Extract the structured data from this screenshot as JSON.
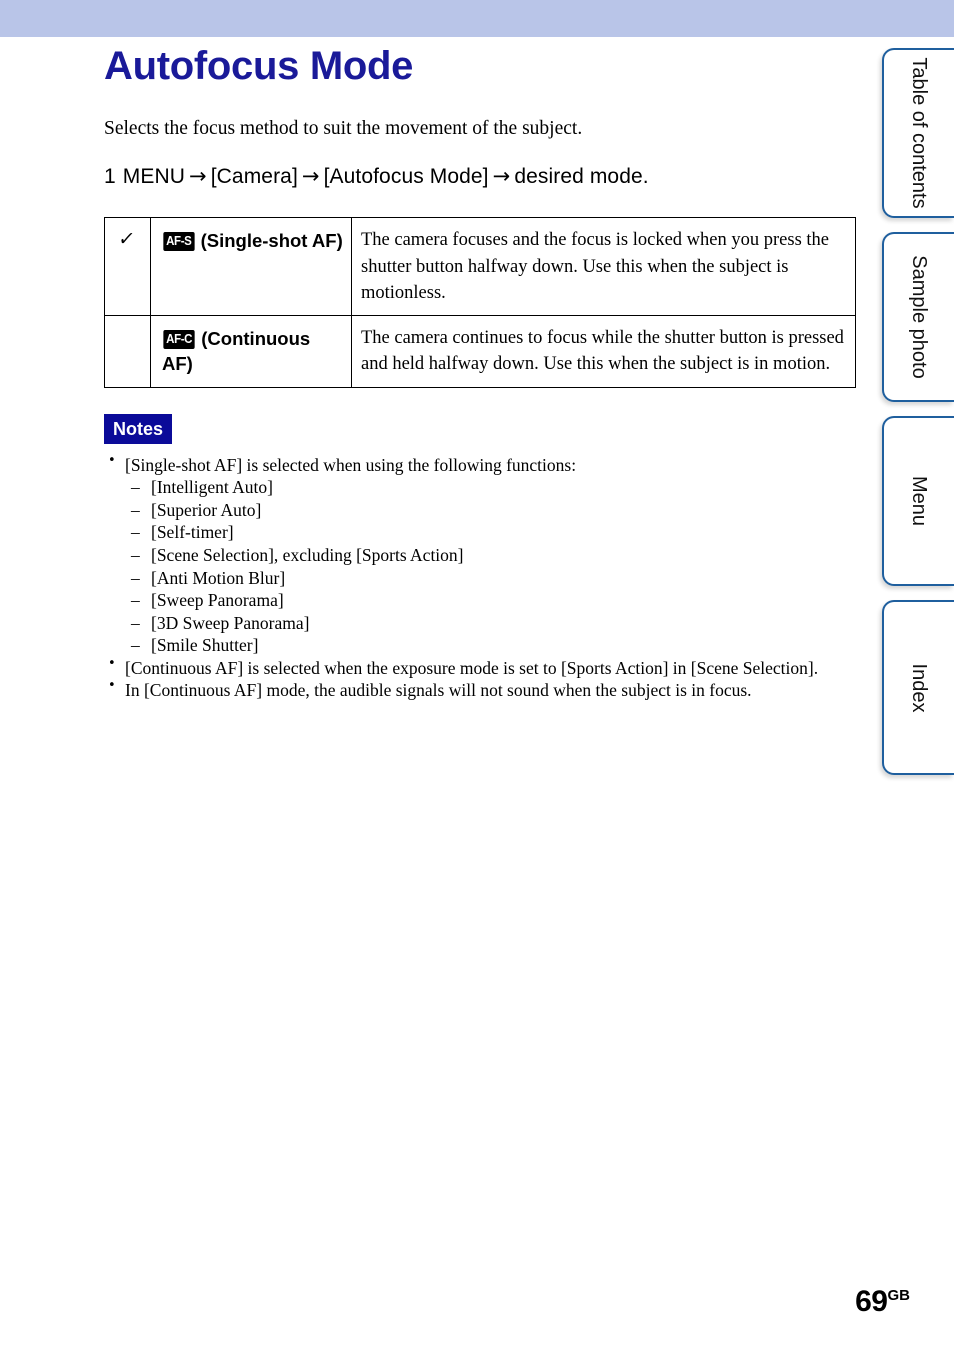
{
  "document": {
    "title": "Autofocus Mode",
    "intro": "Selects the focus method to suit the movement of the subject.",
    "page_number": "69",
    "page_suffix": "GB",
    "title_color": "#1a1a99",
    "band_color": "#b9c5e8",
    "notes_badge_color": "#0b0b99",
    "tab_border_color": "#1f5f9e"
  },
  "step": {
    "number": "1",
    "menu": "MENU",
    "arrow": "→",
    "part1": "[Camera]",
    "part2": "[Autofocus Mode]",
    "part3": "desired mode."
  },
  "options_table": {
    "rows": [
      {
        "selected": true,
        "check": "✓",
        "badge": "AF-S",
        "mode_label": "(Single-shot AF)",
        "description": "The camera focuses and the focus is locked when you press the shutter button halfway down. Use this when the subject is motionless."
      },
      {
        "selected": false,
        "check": "",
        "badge": "AF-C",
        "mode_label": "(Continuous AF)",
        "description": "The camera continues to focus while the shutter button is pressed and held halfway down. Use this when the subject is in motion."
      }
    ]
  },
  "notes": {
    "heading": "Notes",
    "bullet_glyph": "•",
    "dash_glyph": "–",
    "items": [
      {
        "text": "[Single-shot AF] is selected when using the following functions:",
        "sub_items": [
          "[Intelligent Auto]",
          "[Superior Auto]",
          "[Self-timer]",
          "[Scene Selection], excluding [Sports Action]",
          "[Anti Motion Blur]",
          "[Sweep Panorama]",
          "[3D Sweep Panorama]",
          "[Smile Shutter]"
        ]
      },
      {
        "text": "[Continuous AF] is selected when the exposure mode is set to [Sports Action] in [Scene Selection].",
        "sub_items": []
      },
      {
        "text": "In [Continuous AF] mode, the audible signals will not sound when the subject is in focus.",
        "sub_items": []
      }
    ]
  },
  "side_tabs": [
    {
      "label": "Table of contents",
      "two_line": true
    },
    {
      "label": "Sample photo",
      "two_line": false
    },
    {
      "label": "Menu",
      "two_line": false
    },
    {
      "label": "Index",
      "two_line": false
    }
  ]
}
